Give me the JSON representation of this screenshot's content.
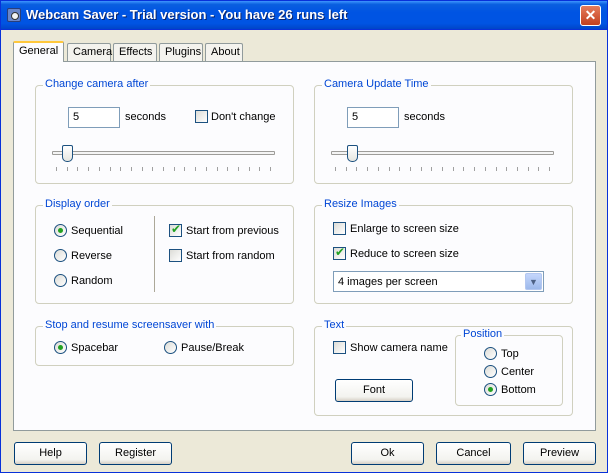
{
  "window": {
    "title": "Webcam Saver  - Trial version - You have 26 runs left",
    "close_label": "✕"
  },
  "tabs": [
    "General",
    "Camera",
    "Effects",
    "Plugins",
    "About"
  ],
  "change_camera": {
    "title": "Change camera after",
    "value": "5",
    "unit": "seconds",
    "dont_change_label": "Don't change",
    "dont_change_checked": false,
    "slider_level": 0.05
  },
  "update_time": {
    "title": "Camera Update Time",
    "value": "5",
    "unit": "seconds",
    "slider_level": 0.08
  },
  "display_order": {
    "title": "Display order",
    "options": [
      "Sequential",
      "Reverse",
      "Random"
    ],
    "selected": "Sequential",
    "start_from_previous": "Start from previous",
    "start_from_previous_checked": true,
    "start_from_random": "Start from random",
    "start_from_random_checked": false
  },
  "resize": {
    "title": "Resize Images",
    "enlarge": "Enlarge to screen size",
    "enlarge_checked": false,
    "reduce": "Reduce to screen size",
    "reduce_checked": true,
    "per_screen": "4 images per screen"
  },
  "stop_resume": {
    "title": "Stop and resume screensaver with",
    "options": [
      "Spacebar",
      "Pause/Break"
    ],
    "selected": "Spacebar"
  },
  "text": {
    "title": "Text",
    "show_camera_name": "Show camera name",
    "show_camera_name_checked": false,
    "font_button": "Font",
    "position_title": "Position",
    "positions": [
      "Top",
      "Center",
      "Bottom"
    ],
    "position_selected": "Bottom"
  },
  "buttons": {
    "help": "Help",
    "register": "Register",
    "ok": "Ok",
    "cancel": "Cancel",
    "preview": "Preview"
  },
  "colors": {
    "titlebar": "#0054e3",
    "group_label": "#0046d5",
    "window_bg": "#ece9d8",
    "check_green": "#21a121"
  }
}
